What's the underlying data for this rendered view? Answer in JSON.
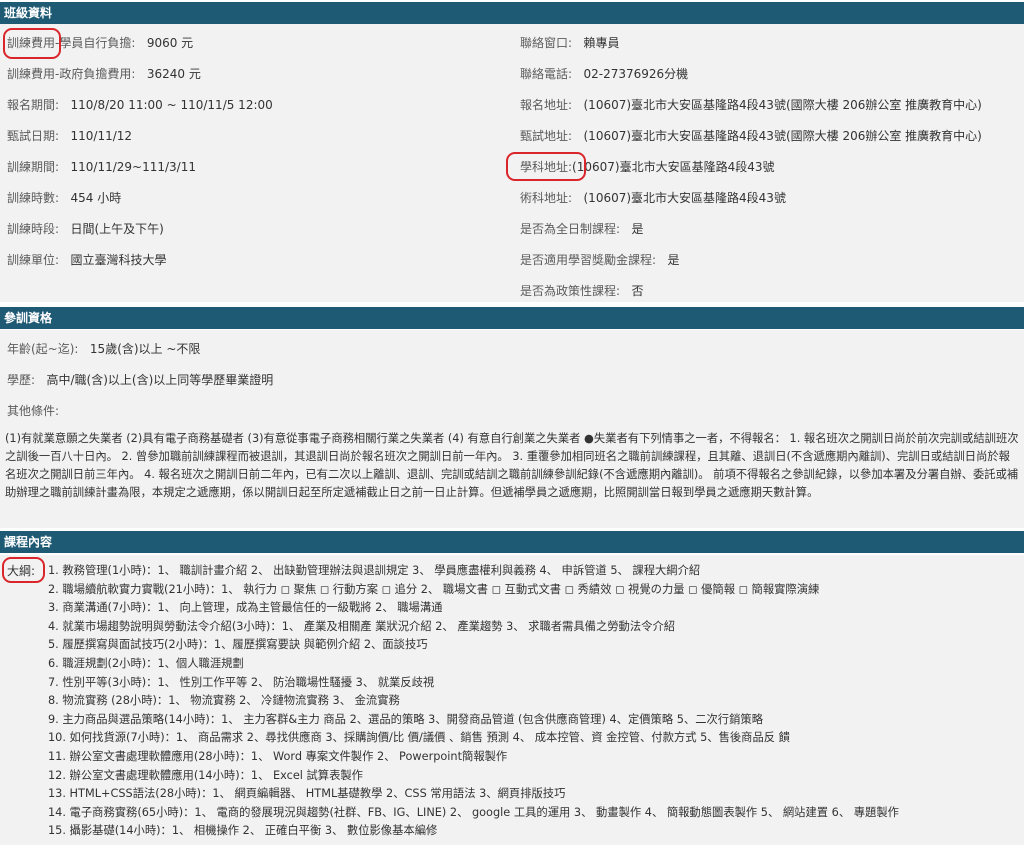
{
  "sections": {
    "class_info": "班級資料",
    "qualification": "參訓資格",
    "course_content": "課程內容"
  },
  "class_info": {
    "left": [
      {
        "label": "訓練費用-學員自行負擔:",
        "value": "9060 元"
      },
      {
        "label": "訓練費用-政府負擔費用:",
        "value": "36240 元"
      },
      {
        "label": "報名期間:",
        "value": "110/8/20 11:00 ~ 110/11/5 12:00"
      },
      {
        "label": "甄試日期:",
        "value": "110/11/12"
      },
      {
        "label": "訓練期間:",
        "value": "110/11/29~111/3/11"
      },
      {
        "label": "訓練時數:",
        "value": "454 小時"
      },
      {
        "label": "訓練時段:",
        "value": "日間(上午及下午)"
      },
      {
        "label": "訓練單位:",
        "value": "國立臺灣科技大學"
      }
    ],
    "right": [
      {
        "label": "聯絡窗口:",
        "value": "賴專員"
      },
      {
        "label": "聯絡電話:",
        "value": "02-27376926分機"
      },
      {
        "label": "報名地址:",
        "value": "(10607)臺北市大安區基隆路4段43號(國際大樓 206辦公室 推廣教育中心)"
      },
      {
        "label": "甄試地址:",
        "value": "(10607)臺北市大安區基隆路4段43號(國際大樓 206辦公室 推廣教育中心)"
      },
      {
        "label": "學科地址:",
        "value": "(10607)臺北市大安區基隆路4段43號"
      },
      {
        "label": "術科地址:",
        "value": "(10607)臺北市大安區基隆路4段43號"
      },
      {
        "label": "是否為全日制課程:",
        "value": "是"
      },
      {
        "label": "是否適用學習獎勵金課程:",
        "value": "是"
      },
      {
        "label": "是否為政策性課程:",
        "value": "否"
      }
    ]
  },
  "qualification": {
    "age_label": "年齡(起~迄):",
    "age_value": "15歲(含)以上 ~不限",
    "edu_label": "學歷:",
    "edu_value": "高中/職(含)以上(含)以上同等學歷畢業證明",
    "other_label": "其他條件:",
    "other_text": "(1)有就業意願之失業者 (2)具有電子商務基礎者 (3)有意從事電子商務相關行業之失業者 (4) 有意自行創業之失業者 ●失業者有下列情事之一者，不得報名： 1. 報名班次之開訓日尚於前次完訓或結訓班次之訓後一百八十日內。 2. 曾參加職前訓練課程而被退訓，其退訓日尚於報名班次之開訓日前一年內。 3. 重覆參加相同班名之職前訓練課程，且其離、退訓日(不含遞應期內離訓)、完訓日或結訓日尚於報名班次之開訓日前三年內。 4. 報名班次之開訓日前二年內，已有二次以上離訓、退訓、完訓或結訓之職前訓練參訓紀錄(不含遞應期內離訓)。 前項不得報名之參訓紀錄，以參加本署及分署自辦、委託或補助辦理之職前訓練計畫為限，本規定之遞應期，係以開訓日起至所定遞補截止日之前一日止計算。但遞補學員之遞應期，比照開訓當日報到學員之遞應期天數計算。"
  },
  "course": {
    "outline_label": "大綱:",
    "items": [
      "1. 教務管理(1小時)：1、 職訓計畫介紹 2、 出缺勤管理辦法與退訓規定 3、 學員應盡權利與義務 4、 申訴管道 5、 課程大綱介紹",
      "2. 職場續航軟實力實戰(21小時)：1、 執行力 ◻ 聚焦 ◻ 行動方案 ◻ 追分 2、 職場文書 ◻ 互動式文書 ◻ 秀績效 ◻ 視覺の力量 ◻ 優簡報 ◻ 簡報實際演練",
      "3. 商業溝通(7小時)：1、 向上管理，成為主管最信任的一級戰將 2、 職場溝通",
      "4. 就業市場趨勢說明與勞動法令介紹(3小時)：1、 產業及相關產 業狀況介紹 2、 產業趨勢 3、 求職者需具備之勞動法令介紹",
      "5. 履歷撰寫與面試技巧(2小時)：1、履歷撰寫要訣 與範例介紹 2、面談技巧",
      "6. 職涯規劃(2小時)：1、個人職涯規劃",
      "7. 性別平等(3小時)：1、 性別工作平等 2、 防治職場性騷擾 3、 就業反歧視",
      "8. 物流實務 (28小時)：1、 物流實務 2、 冷鏈物流實務 3、 金流實務",
      "9. 主力商品與選品策略(14小時)：1、 主力客群&主力 商品 2、選品的策略 3、開發商品管道 (包含供應商管理) 4、定價策略 5、二次行銷策略",
      "10. 如何找貨源(7小時)：1、 商品需求 2、尋找供應商 3、採購詢價/比 價/議價 、銷售 預測 4、 成本控管、資 金控管、付款方式 5、售後商品反 饋",
      "11. 辦公室文書處理軟體應用(28小時)：1、 Word 專案文件製作 2、 Powerpoint簡報製作",
      "12. 辦公室文書處理軟體應用(14小時)：1、 Excel 試算表製作",
      "13. HTML+CSS語法(28小時)：1、 網頁編輯器、 HTML基礎教學 2、CSS 常用語法 3、網頁排版技巧",
      "14. 電子商務實務(65小時)：1、 電商的發展現況與趨勢(社群、FB、IG、LINE) 2、 google 工具的運用 3、 動畫製作 4、 簡報動態圖表製作 5、 網站建置 6、 專題製作",
      "15. 攝影基礎(14小時)：1、 相機操作 2、 正確白平衡 3、 數位影像基本編修"
    ]
  },
  "highlight_color": "#d9262b",
  "header_color": "#1f5a75"
}
